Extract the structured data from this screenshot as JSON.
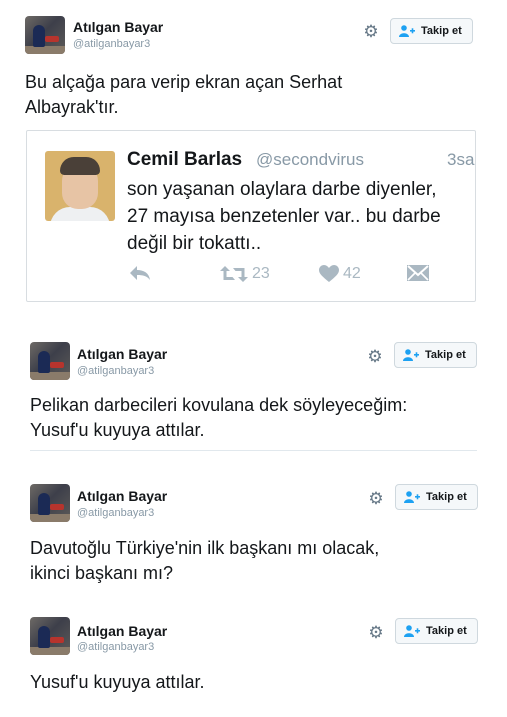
{
  "tweets": [
    {
      "name": "Atılgan Bayar",
      "handle": "@atilganbayar3",
      "follow_label": "Takip et",
      "text_lines": [
        "Bu alçağa para verip ekran açan Serhat",
        "Albayrak'tır."
      ]
    },
    {
      "name": "Atılgan Bayar",
      "handle": "@atilganbayar3",
      "follow_label": "Takip et",
      "text_lines": [
        "Pelikan darbecileri kovulana dek söyleyeceğim:",
        "Yusuf'u kuyuya attılar."
      ]
    },
    {
      "name": "Atılgan Bayar",
      "handle": "@atilganbayar3",
      "follow_label": "Takip et",
      "text_lines": [
        "Davutoğlu Türkiye'nin ilk başkanı mı olacak,",
        "ikinci başkanı mı?"
      ]
    },
    {
      "name": "Atılgan Bayar",
      "handle": "@atilganbayar3",
      "follow_label": "Takip et",
      "text_lines": [
        "Yusuf'u kuyuya attılar."
      ]
    }
  ],
  "quoted": {
    "name": "Cemil Barlas",
    "handle": "@secondvirus",
    "time": "3sa",
    "text_lines": [
      "son yaşanan olaylara darbe diyenler,",
      "27 mayısa benzetenler var.. bu darbe",
      "değil bir tokattı.."
    ],
    "retweets": "23",
    "likes": "42"
  },
  "icons": {
    "settings": "gear-icon",
    "follow": "add-user-icon",
    "reply": "reply-icon",
    "retweet": "retweet-icon",
    "like": "heart-icon",
    "message": "envelope-icon"
  }
}
